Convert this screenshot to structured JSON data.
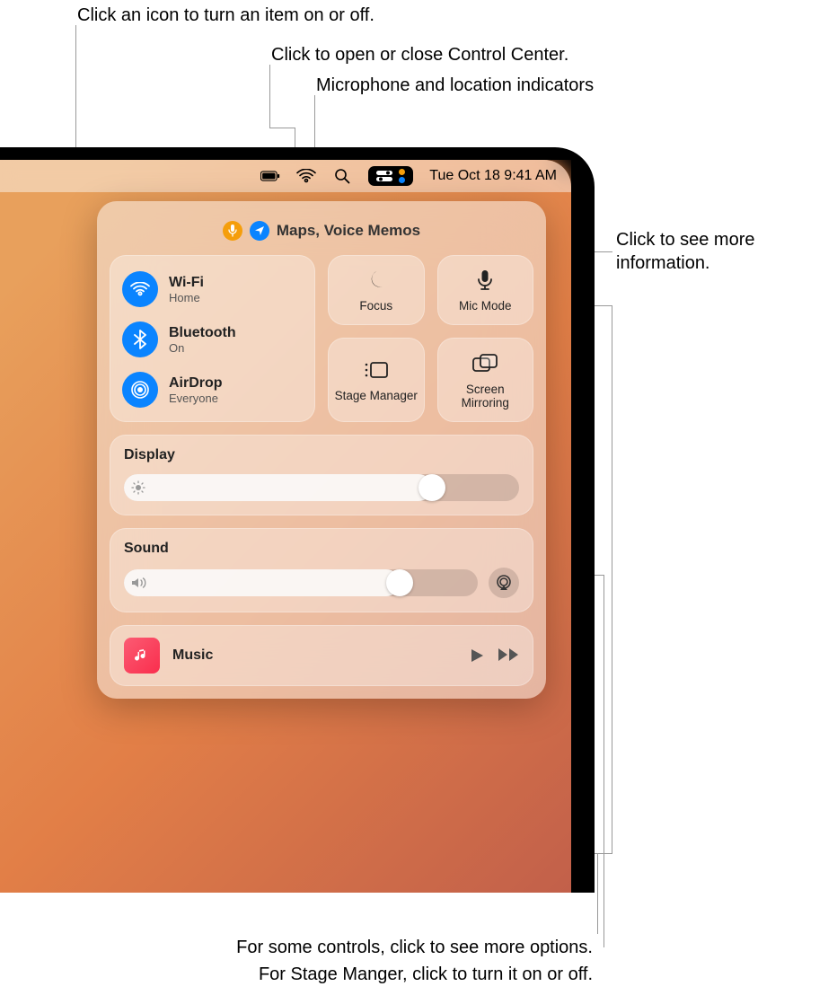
{
  "callouts": {
    "toggle_icon": "Click an icon to turn an item on or off.",
    "open_close": "Click to open or close Control Center.",
    "mic_location": "Microphone and location indicators",
    "more_info": "Click to see more information.",
    "more_options": "For some controls, click to see more options.",
    "stage_manager_note": "For Stage Manger, click to turn it on or off."
  },
  "menubar": {
    "datetime": "Tue Oct 18  9:41 AM"
  },
  "privacy": {
    "apps": "Maps, Voice Memos"
  },
  "connectivity": {
    "wifi": {
      "title": "Wi-Fi",
      "sub": "Home"
    },
    "bluetooth": {
      "title": "Bluetooth",
      "sub": "On"
    },
    "airdrop": {
      "title": "AirDrop",
      "sub": "Everyone"
    }
  },
  "tiles": {
    "focus": "Focus",
    "mic_mode": "Mic Mode",
    "stage_manager": "Stage Manager",
    "screen_mirroring": "Screen Mirroring"
  },
  "sliders": {
    "display": {
      "title": "Display",
      "value_pct": 78
    },
    "sound": {
      "title": "Sound",
      "value_pct": 78
    }
  },
  "music": {
    "title": "Music"
  }
}
